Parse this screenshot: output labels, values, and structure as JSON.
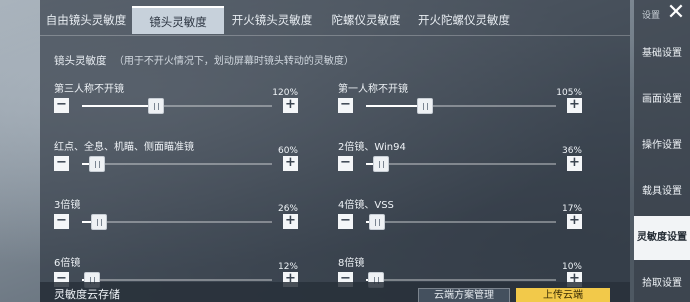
{
  "tabs": [
    {
      "label": "自由镜头灵敏度",
      "active": false
    },
    {
      "label": "镜头灵敏度",
      "active": true
    },
    {
      "label": "开火镜头灵敏度",
      "active": false
    },
    {
      "label": "陀螺仪灵敏度",
      "active": false
    },
    {
      "label": "开火陀螺仪灵敏度",
      "active": false
    }
  ],
  "intro": {
    "title": "镜头灵敏度",
    "note": "（用于不开火情况下，划动屏幕时镜头转动的灵敏度）"
  },
  "sliders": [
    {
      "label": "第三人称不开镜",
      "value": "120%",
      "fraction": 0.39
    },
    {
      "label": "第一人称不开镜",
      "value": "105%",
      "fraction": 0.31
    },
    {
      "label": "红点、全息、机瞄、侧面瞄准镜",
      "value": "60%",
      "fraction": 0.08
    },
    {
      "label": "2倍镜、Win94",
      "value": "36%",
      "fraction": 0.08
    },
    {
      "label": "3倍镜",
      "value": "26%",
      "fraction": 0.09
    },
    {
      "label": "4倍镜、VSS",
      "value": "17%",
      "fraction": 0.06
    },
    {
      "label": "6倍镜",
      "value": "12%",
      "fraction": 0.05
    },
    {
      "label": "8倍镜",
      "value": "10%",
      "fraction": 0.05
    }
  ],
  "buttons": {
    "minus": "−",
    "plus": "+"
  },
  "bottom": {
    "title": "灵敏度云存储",
    "manage_label": "云端方案管理",
    "upload_label": "上传云端"
  },
  "sidebar": {
    "title": "设置",
    "close": "✕",
    "items": [
      {
        "label": "基础设置",
        "active": false
      },
      {
        "label": "画面设置",
        "active": false
      },
      {
        "label": "操作设置",
        "active": false
      },
      {
        "label": "载具设置",
        "active": false
      },
      {
        "label": "灵敏度设置",
        "active": true
      },
      {
        "label": "拾取设置",
        "active": false
      }
    ]
  },
  "colors": {
    "accent_yellow": "#f2c94a",
    "active_tab_bg": "#cdd7e1",
    "panel": "#262e3a"
  }
}
